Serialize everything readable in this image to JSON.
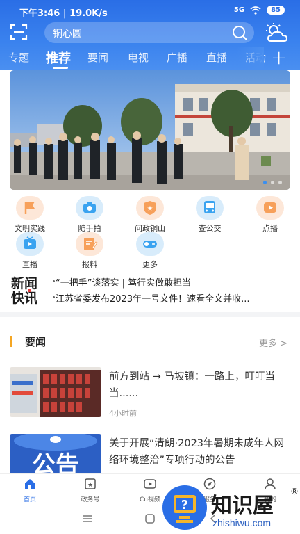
{
  "status_bar": {
    "time": "下午3:46",
    "speed": "19.0K/s",
    "network": "5G",
    "battery": "85"
  },
  "search": {
    "placeholder": "铜心圆"
  },
  "tabs": [
    {
      "label": "专题"
    },
    {
      "label": "推荐"
    },
    {
      "label": "要闻"
    },
    {
      "label": "电视"
    },
    {
      "label": "广播"
    },
    {
      "label": "直播"
    },
    {
      "label": "活动"
    }
  ],
  "active_tab": "推荐",
  "banner": {
    "slides": 3,
    "active_slide": 1
  },
  "shortcuts": [
    {
      "label": "文明实践",
      "icon": "flag-icon",
      "color": "#f7a05a",
      "bg": "#fde7d8"
    },
    {
      "label": "随手拍",
      "icon": "camera-icon",
      "color": "#3aa3f0",
      "bg": "#d8ecfb"
    },
    {
      "label": "问政铜山",
      "icon": "shield-star-icon",
      "color": "#f7a05a",
      "bg": "#fde7d8"
    },
    {
      "label": "查公交",
      "icon": "bus-icon",
      "color": "#3aa3f0",
      "bg": "#d8ecfb"
    },
    {
      "label": "点播",
      "icon": "play-icon",
      "color": "#f7a05a",
      "bg": "#fde7d8"
    },
    {
      "label": "直播",
      "icon": "tv-icon",
      "color": "#3aa3f0",
      "bg": "#d8ecfb"
    },
    {
      "label": "报料",
      "icon": "edit-icon",
      "color": "#f7a05a",
      "bg": "#fde7d8"
    },
    {
      "label": "更多",
      "icon": "toggle-icon",
      "color": "#3aa3f0",
      "bg": "#d8ecfb"
    }
  ],
  "news_flash": {
    "logo_text": "新闻快讯",
    "items": [
      "“一把手”谈落实 | 笃行实做敢担当",
      "江苏省委发布2023年一号文件！速看全文并收..."
    ]
  },
  "section": {
    "title": "要闻",
    "more": "更多 >"
  },
  "news": [
    {
      "title": "前方到站 → 马坡镇：一路上，叮叮当当......",
      "time": "4小时前"
    },
    {
      "title": "关于开展“清朗·2023年暑期未成年人网络环境整治”专项行动的公告",
      "time": ""
    }
  ],
  "bottom_nav": [
    {
      "label": "首页",
      "icon": "home-icon"
    },
    {
      "label": "政务号",
      "icon": "government-icon"
    },
    {
      "label": "Cu视频",
      "icon": "video-icon"
    },
    {
      "label": "服务",
      "icon": "compass-icon"
    },
    {
      "label": "我的",
      "icon": "user-icon"
    }
  ],
  "watermark": {
    "text": "知识屋",
    "sub": "zhishiwu.com",
    "reg": "®"
  },
  "colors": {
    "brand_blue": "#2a6ee6",
    "accent_orange": "#f5a623"
  }
}
